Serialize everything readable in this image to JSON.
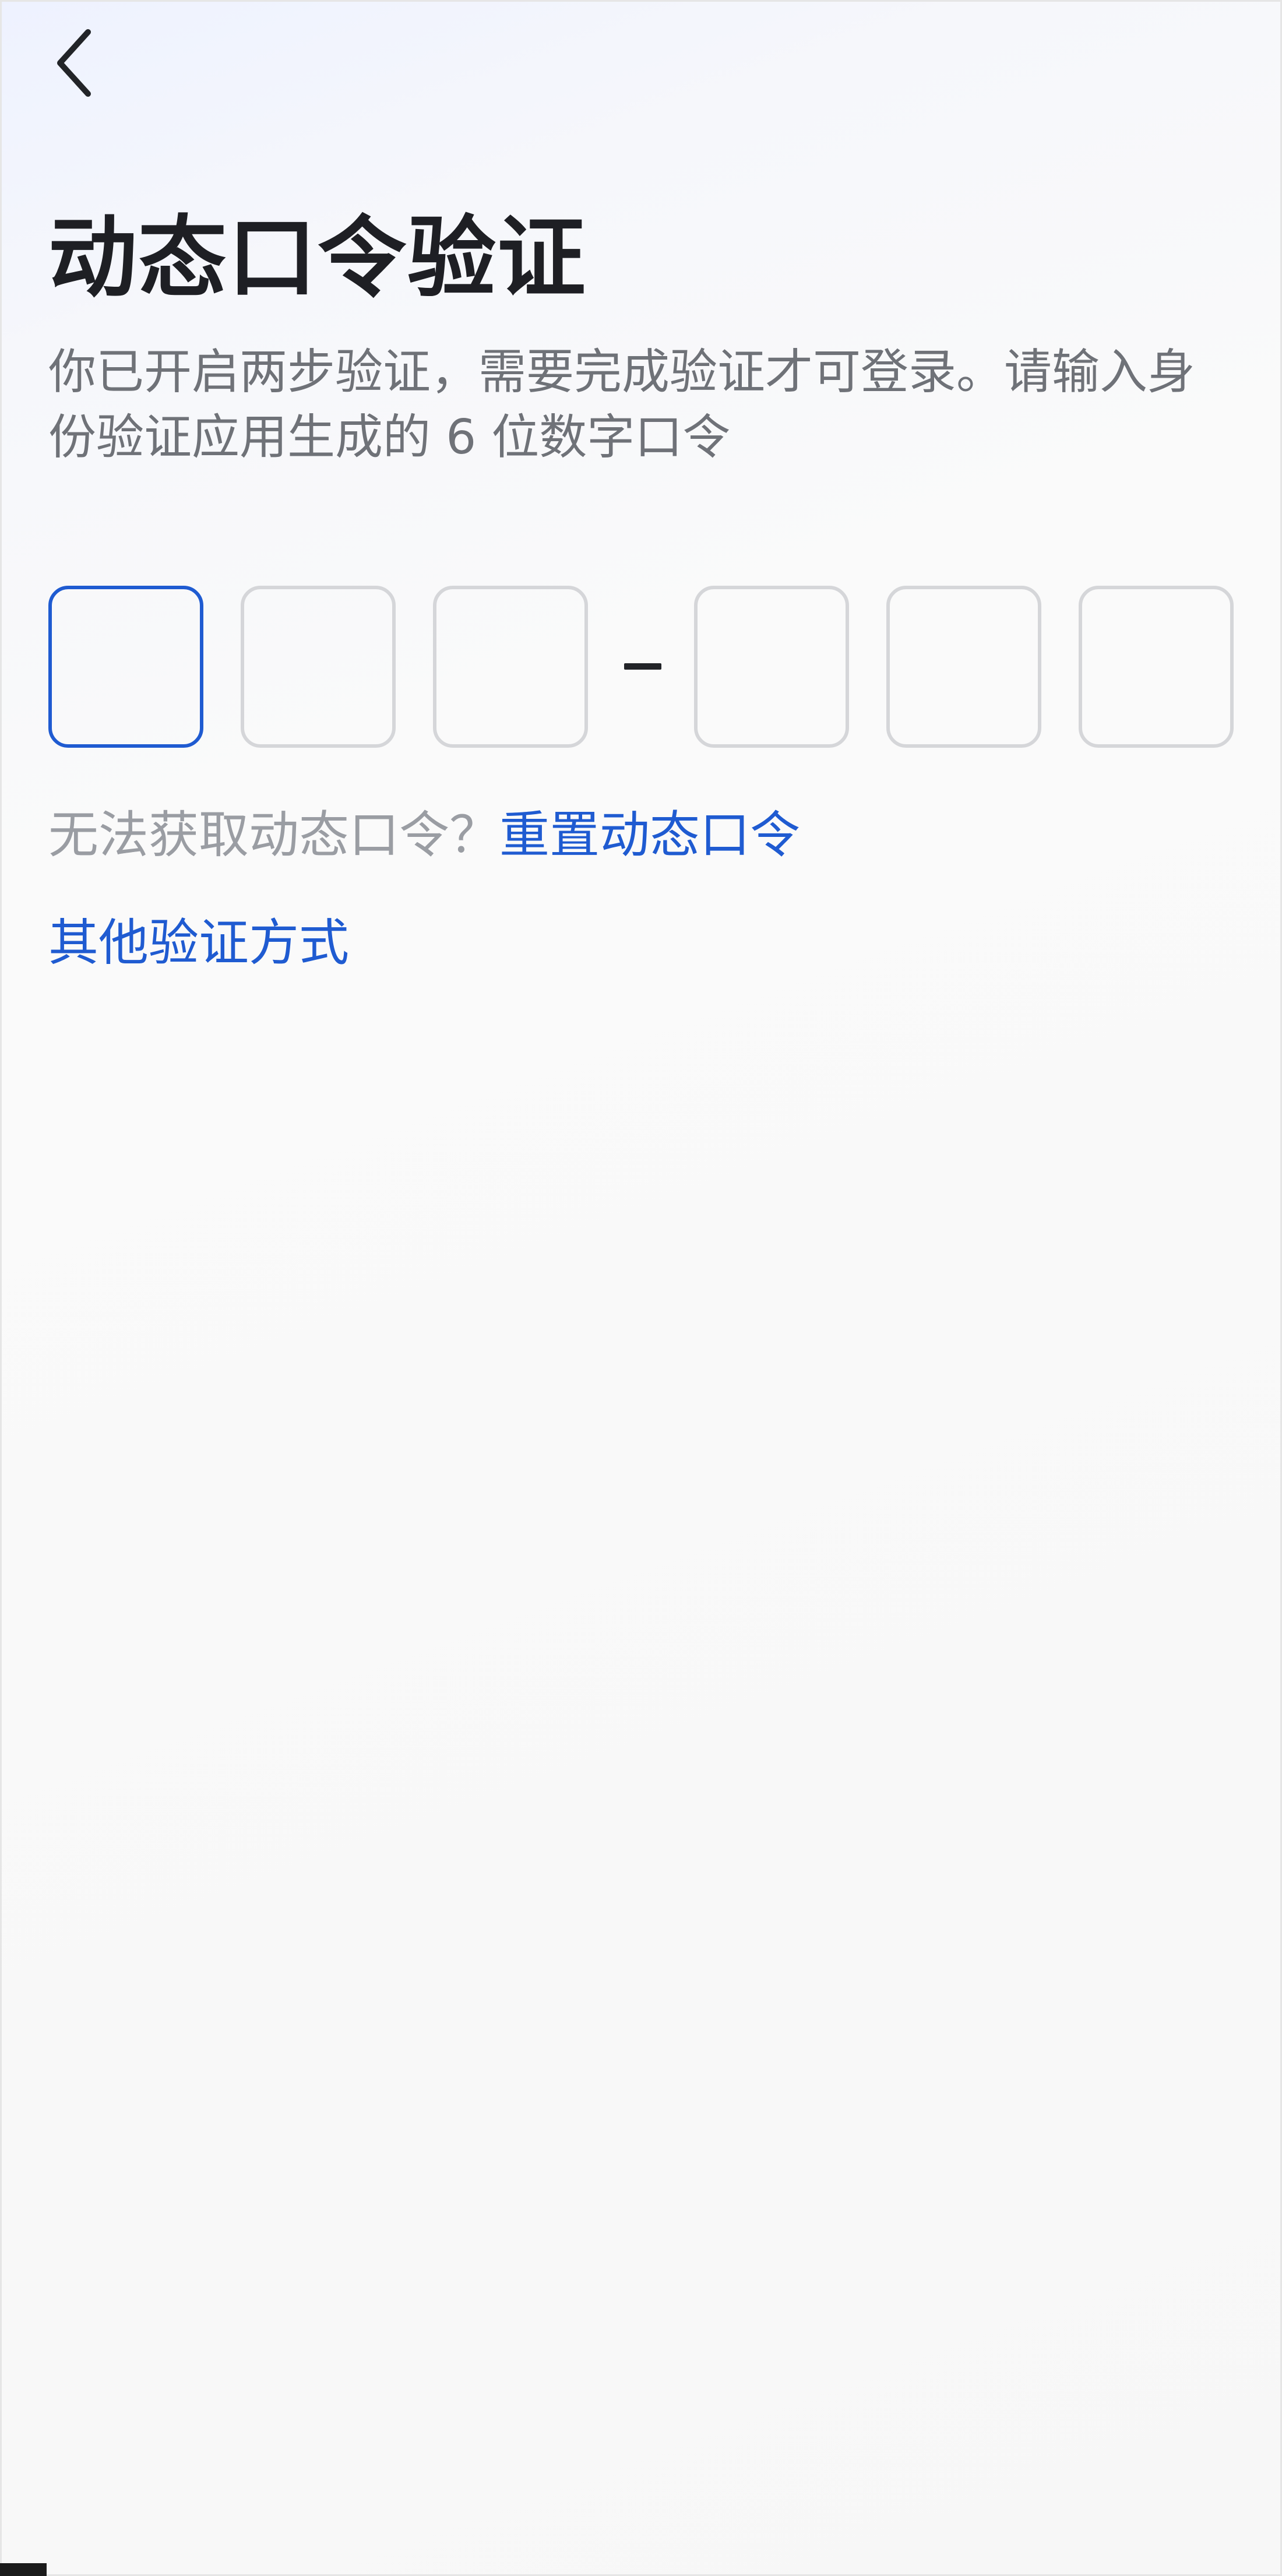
{
  "header": {
    "back_icon": "chevron-left-icon",
    "title": "动态口令验证"
  },
  "description": "你已开启两步验证，需要完成验证才可登录。请输入身份验证应用生成的 6 位数字口令",
  "otp": {
    "digits": [
      "",
      "",
      "",
      "",
      "",
      ""
    ],
    "separator": "–",
    "active_index": 0
  },
  "help": {
    "prompt": "无法获取动态口令？",
    "reset_link": "重置动态口令"
  },
  "other_methods_link": "其他验证方式",
  "colors": {
    "accent": "#1f5bd1",
    "title": "#1e1f24",
    "muted": "#9a9da3",
    "box_border": "#d5d6d9"
  }
}
